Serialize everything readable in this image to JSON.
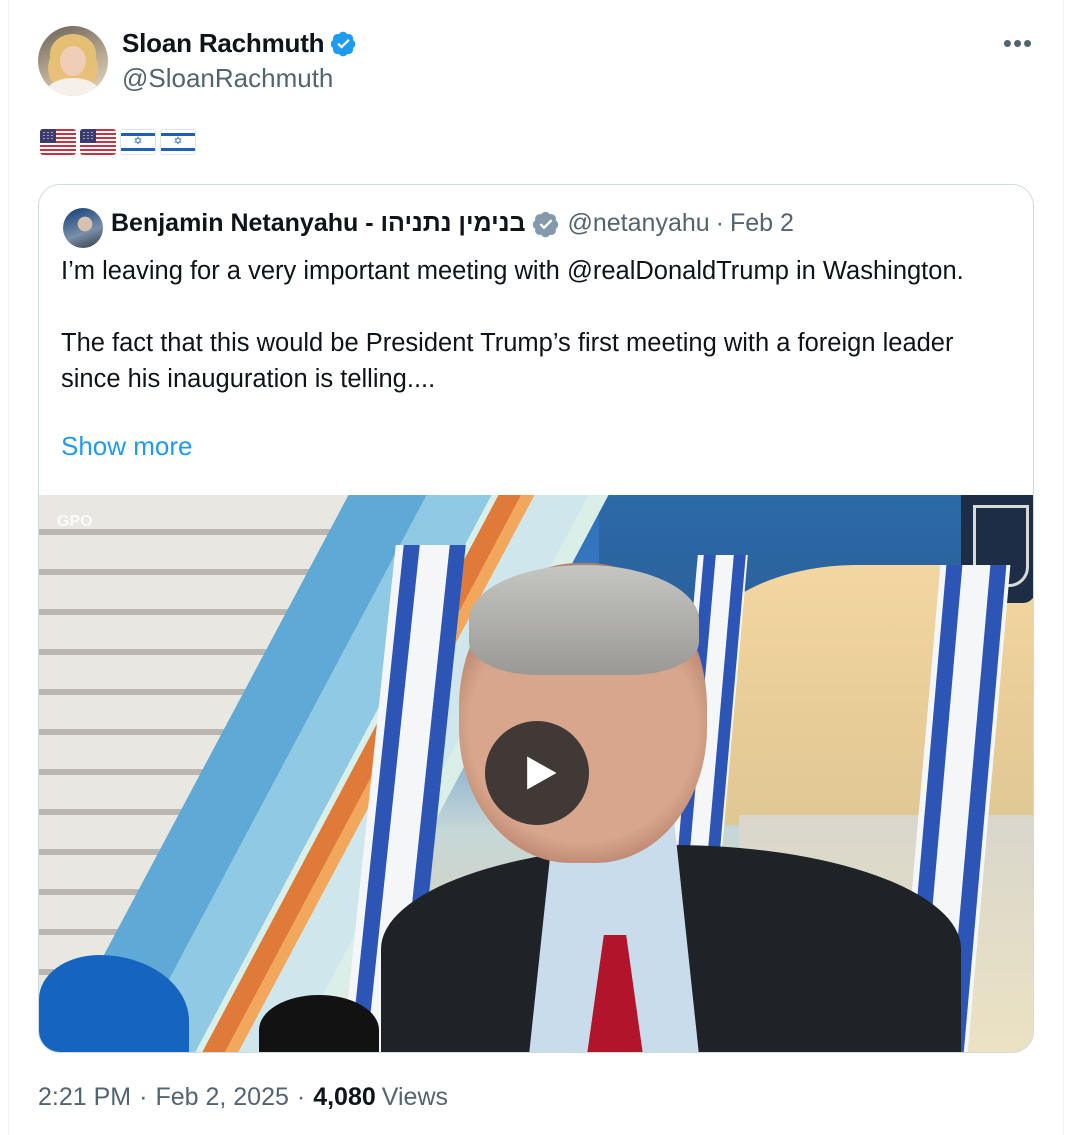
{
  "tweet": {
    "author_name": "Sloan Rachmuth",
    "author_handle": "@SloanRachmuth",
    "verified": true,
    "more_label": "•••",
    "flags": [
      "us-flag",
      "us-flag",
      "israel-flag",
      "israel-flag"
    ],
    "time": "2:21 PM",
    "date": "Feb 2, 2025",
    "separator": "·",
    "views_count": "4,080",
    "views_label": "Views"
  },
  "quote": {
    "author_name": "Benjamin Netanyahu - בנימין נתניהו",
    "author_handle": "@netanyahu",
    "separator": "·",
    "date": "Feb 2",
    "verified_badge": "gray-verified-icon",
    "text": "I’m leaving for a very important meeting with @realDonaldTrump in Washington.\n\nThe fact that this would be President Trump’s first meeting with a foreign leader since his inauguration is telling....",
    "show_more": "Show more",
    "media": {
      "type": "video",
      "watermark": "GPO",
      "play_icon": "play-icon"
    }
  },
  "colors": {
    "accent": "#1d9bf0",
    "secondary_text": "#536471",
    "primary_text": "#0f1419",
    "border": "#cfd9de"
  }
}
